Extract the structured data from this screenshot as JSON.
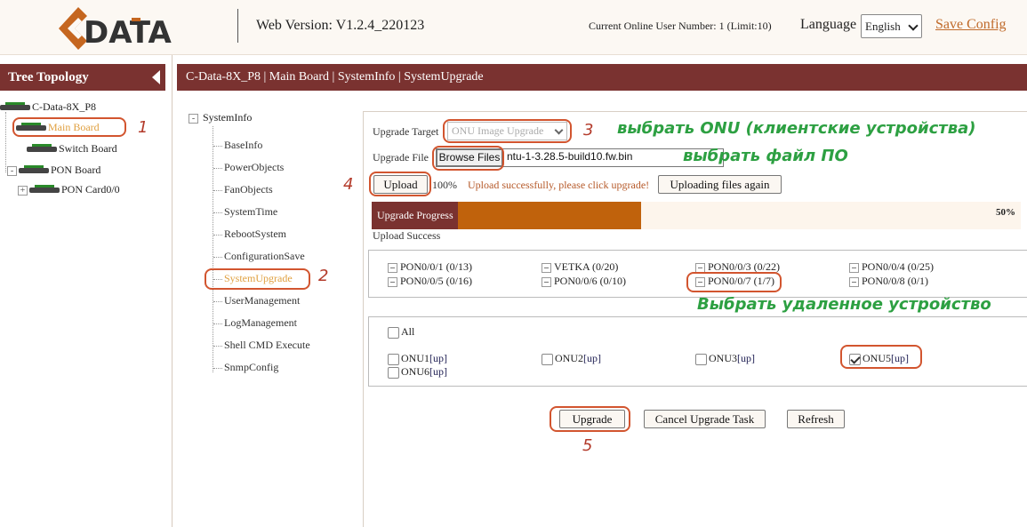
{
  "header": {
    "web_version": "Web Version: V1.2.4_220123",
    "online_users": "Current Online User Number: 1 (Limit:10)",
    "language_label": "Language",
    "language_value": "English",
    "save_config": "Save Config"
  },
  "tree": {
    "title": "Tree Topology",
    "nodes": [
      "C-Data-8X_P8",
      "Main Board",
      "Switch Board",
      "PON Board",
      "PON Card0/0"
    ]
  },
  "breadcrumb": "C-Data-8X_P8 | Main Board | SystemInfo | SystemUpgrade",
  "menu": {
    "root": "SystemInfo",
    "items": [
      "BaseInfo",
      "PowerObjects",
      "FanObjects",
      "SystemTime",
      "RebootSystem",
      "ConfigurationSave",
      "SystemUpgrade",
      "UserManagement",
      "LogManagement",
      "Shell CMD Execute",
      "SnmpConfig"
    ]
  },
  "upgrade": {
    "target_label": "Upgrade Target",
    "target_value": "ONU Image Upgrade",
    "file_label": "Upgrade File",
    "browse_label": "Browse Files",
    "file_name": "ntu-1-3.28.5-build10.fw.bin",
    "upload_label": "Upload",
    "upload_percent": "100%",
    "upload_message": "Upload successfully, please click upgrade!",
    "reupload_label": "Uploading files again",
    "progress_label": "Upgrade Progress",
    "progress_value": 50,
    "progress_text": "50%",
    "upload_status": "Upload Success",
    "upgrade_label": "Upgrade",
    "cancel_label": "Cancel Upgrade Task",
    "refresh_label": "Refresh"
  },
  "pon_ports": [
    "PON0/0/1 (0/13)",
    "VETKA (0/20)",
    "PON0/0/3 (0/22)",
    "PON0/0/4 (0/25)",
    "PON0/0/5 (0/16)",
    "PON0/0/6 (0/10)",
    "PON0/0/7 (1/7)",
    "PON0/0/8 (0/1)"
  ],
  "onu": {
    "all_label": "All",
    "items": [
      {
        "name": "ONU1",
        "status": "[up]",
        "checked": false
      },
      {
        "name": "ONU2",
        "status": "[up]",
        "checked": false
      },
      {
        "name": "ONU3",
        "status": "[up]",
        "checked": false
      },
      {
        "name": "ONU5",
        "status": "[up]",
        "checked": true
      },
      {
        "name": "ONU6",
        "status": "[up]",
        "checked": false
      }
    ]
  },
  "annotations": {
    "n1": "1",
    "n2": "2",
    "n3": "3",
    "n4": "4",
    "n5": "5",
    "select_onu": "выбрать ONU (клиентские устройства)",
    "select_file": "выбрать файл ПО",
    "select_remote": "Выбрать удаленное устройство"
  },
  "colors": {
    "brand": "#7a3230",
    "progress": "#c0620c",
    "annotation_red": "#d2552f",
    "annotation_green": "#2da042",
    "link": "#c06a2a"
  }
}
